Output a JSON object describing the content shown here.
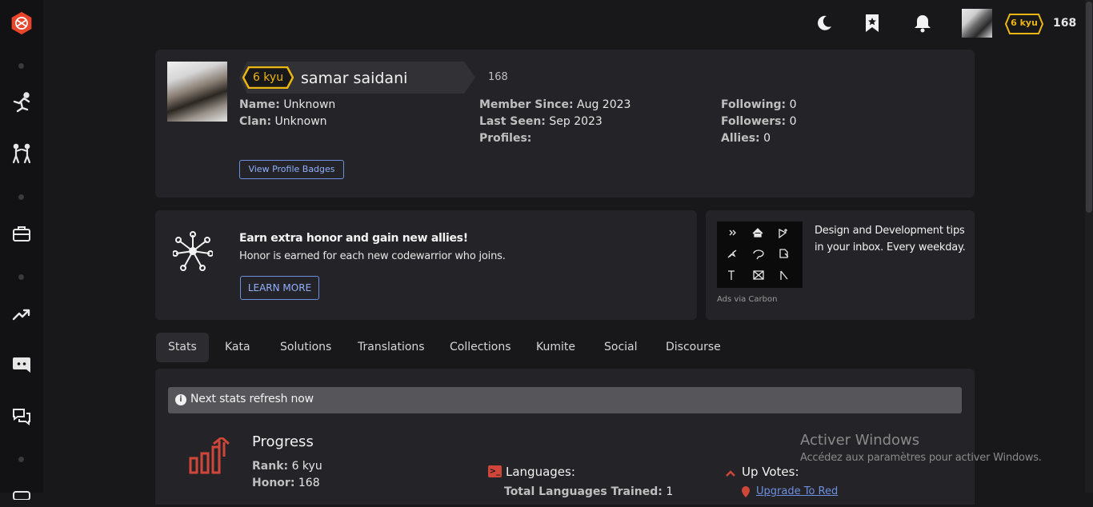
{
  "colors": {
    "accent": "#e8452c",
    "rank_yellow": "#ecb613",
    "link_blue": "#6f8fe0"
  },
  "header": {
    "rank_badge": "6 kyu",
    "honor": "168"
  },
  "profile": {
    "rank_badge": "6 kyu",
    "username": "samar saidani",
    "honor": "168",
    "name_label": "Name:",
    "name_value": "Unknown",
    "clan_label": "Clan:",
    "clan_value": "Unknown",
    "member_since_label": "Member Since:",
    "member_since_value": "Aug 2023",
    "last_seen_label": "Last Seen:",
    "last_seen_value": "Sep 2023",
    "profiles_label": "Profiles:",
    "following_label": "Following:",
    "following_value": "0",
    "followers_label": "Followers:",
    "followers_value": "0",
    "allies_label": "Allies:",
    "allies_value": "0",
    "badges_button": "View Profile Badges"
  },
  "promo": {
    "title": "Earn extra honor and gain new allies!",
    "text": "Honor is earned for each new codewarrior who joins.",
    "button": "LEARN MORE"
  },
  "ad": {
    "text": "Design and Development tips in your inbox. Every weekday.",
    "footer": "Ads via Carbon"
  },
  "tabs": [
    "Stats",
    "Kata",
    "Solutions",
    "Translations",
    "Collections",
    "Kumite",
    "Social",
    "Discourse"
  ],
  "stats": {
    "notice": "Next stats refresh now",
    "progress_title": "Progress",
    "rank_label": "Rank:",
    "rank_value": "6 kyu",
    "honor_label": "Honor:",
    "honor_value": "168",
    "languages_label": "Languages:",
    "languages_trained_label": "Total Languages Trained:",
    "languages_trained_value": "1",
    "upvotes_label": "Up Votes:",
    "upgrade_link": "Upgrade To Red"
  },
  "watermark": {
    "title": "Activer Windows",
    "text": "Accédez aux paramètres pour activer Windows."
  }
}
